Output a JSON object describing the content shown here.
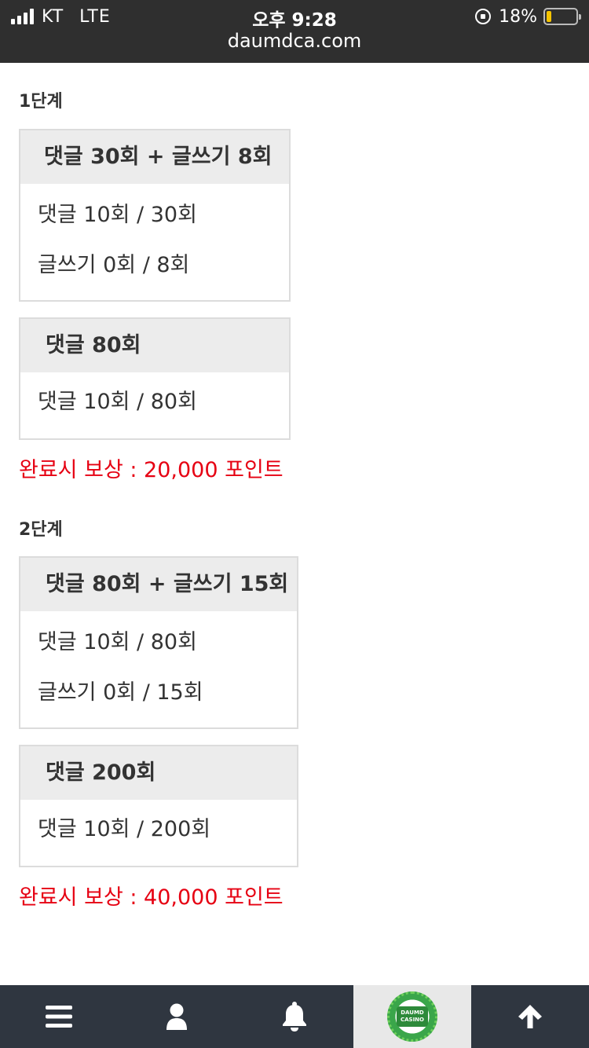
{
  "status_bar": {
    "carrier": "KT",
    "network": "LTE",
    "time": "오후 9:28",
    "url": "daumdca.com",
    "battery_percent": "18%",
    "battery_level": 0.18
  },
  "stages": [
    {
      "title": "1단계",
      "cards": [
        {
          "header": "댓글 30회 + 글쓰기 8회",
          "rows": [
            "댓글 10회 / 30회",
            "글쓰기 0회 / 8회"
          ]
        },
        {
          "header": "댓글 80회",
          "rows": [
            "댓글 10회 / 80회"
          ]
        }
      ],
      "reward": "완료시 보상 : 20,000 포인트"
    },
    {
      "title": "2단계",
      "cards": [
        {
          "header": "댓글 80회 + 글쓰기 15회",
          "rows": [
            "댓글 10회 / 80회",
            "글쓰기 0회 / 15회"
          ]
        },
        {
          "header": "댓글 200회",
          "rows": [
            "댓글 10회 / 200회"
          ]
        }
      ],
      "reward": "완료시 보상 : 40,000 포인트"
    }
  ],
  "bottom_nav": {
    "items": [
      {
        "icon": "menu-icon"
      },
      {
        "icon": "user-icon"
      },
      {
        "icon": "bell-icon"
      },
      {
        "icon": "daumd-casino-logo",
        "label_line1": "DAUMD",
        "label_line2": "CASINO"
      },
      {
        "icon": "arrow-up-icon"
      }
    ]
  }
}
